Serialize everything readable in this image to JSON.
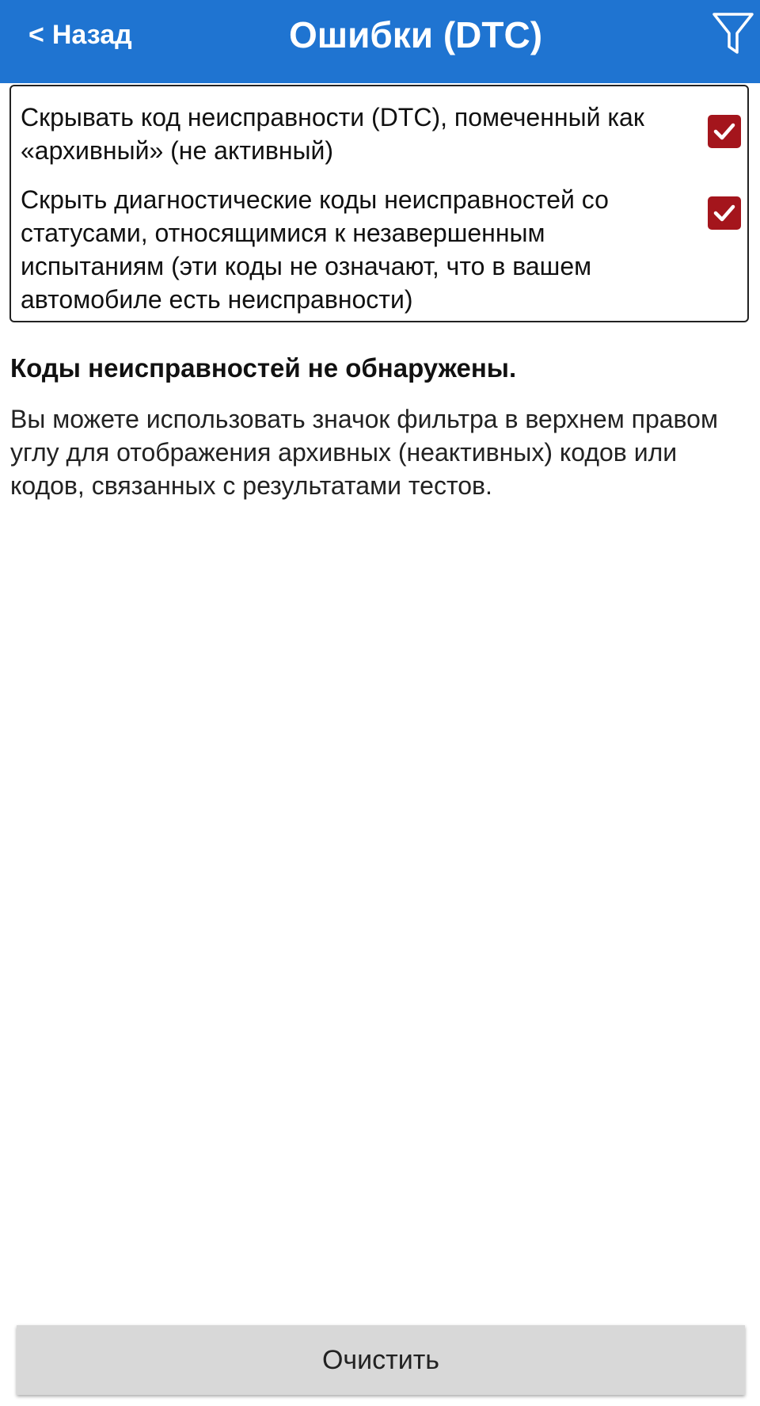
{
  "header": {
    "back_label": "Назад",
    "back_chevron": "<",
    "title": "Ошибки (DTC)",
    "filter_icon": "filter-icon",
    "background_color": "#1f74d1"
  },
  "filters": {
    "items": [
      {
        "label": "Скрывать код неисправности (DTC), помеченный как «архивный» (не активный)",
        "checked": true
      },
      {
        "label": "Скрыть диагностические коды неисправностей со статусами, относящимися к незавершенным испытаниям (эти коды не означают, что в вашем автомобиле есть неисправности)",
        "checked": true
      }
    ],
    "checkbox_color": "#a4151c"
  },
  "result": {
    "title": "Коды неисправностей не обнаружены.",
    "description": "Вы можете использовать значок фильтра в верхнем правом углу для отображения архивных (неактивных) кодов или кодов, связанных с результатами тестов."
  },
  "footer": {
    "clear_label": "Очистить"
  }
}
